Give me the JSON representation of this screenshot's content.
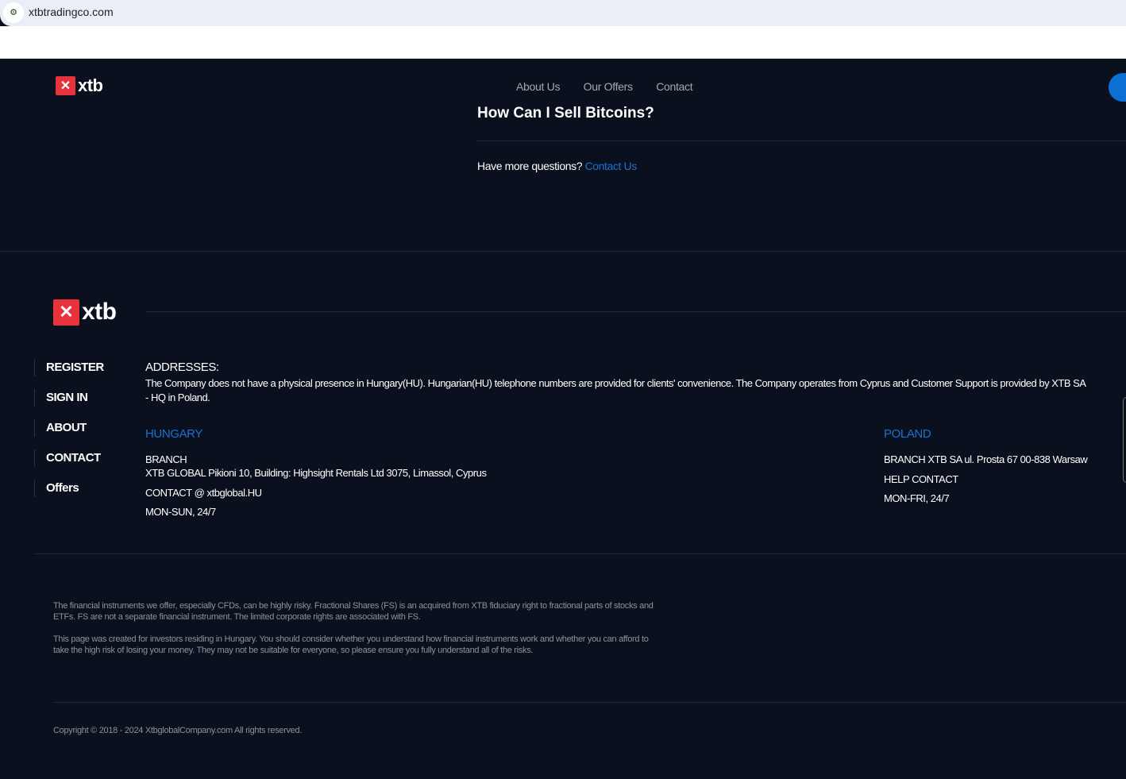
{
  "browser": {
    "url": "xtbtradingco.com",
    "site_info_icon": "tune-icon"
  },
  "header": {
    "logo": "xtb",
    "nav": [
      "About Us",
      "Our Offers",
      "Contact"
    ]
  },
  "faq": {
    "last_question": "How Can I Sell Bitcoins?",
    "more_questions": "Have more questions?",
    "contact_link": "Contact Us"
  },
  "footer": {
    "logo": "xtb",
    "side_links": [
      "REGISTER",
      "SIGN IN",
      "ABOUT",
      "CONTACT",
      "Offers"
    ],
    "addresses_title": "ADDRESSES:",
    "addresses_text": "The Company does not have a physical presence in Hungary(HU). Hungarian(HU) telephone numbers are provided for clients' convenience. The Company operates from Cyprus and Customer Support is provided by XTB SA - HQ in Poland.",
    "hungary": {
      "title": "HUNGARY",
      "branch_label": "BRANCH",
      "branch": "XTB GLOBAL Pikioni 10, Building: Highsight Rentals Ltd 3075, Limassol, Cyprus",
      "contact": "CONTACT @ xtbglobal.HU",
      "hours": "MON-SUN, 24/7"
    },
    "poland": {
      "title": "POLAND",
      "branch": "BRANCH XTB SA ul. Prosta 67 00-838 Warsaw",
      "contact": "HELP CONTACT",
      "hours": "MON-FRI, 24/7"
    },
    "disclaimer1": "The financial instruments we offer, especially CFDs, can be highly risky. Fractional Shares (FS) is an acquired from XTB fiduciary right to fractional parts of stocks and ETFs. FS are not a separate financial instrument. The limited corporate rights are associated with FS.",
    "disclaimer2": "This page was created for investors residing in Hungary. You should consider whether you understand how financial instruments work and whether you can afford to take the high risk of losing your money. They may not be suitable for everyone, so please ensure you fully understand all of the risks.",
    "copyright": "Copyright © 2018 - 2024 XtbglobalCompany.com All rights reserved."
  },
  "colors": {
    "background": "#0a101e",
    "accent": "#1a73d0",
    "logo_red": "#e8323c"
  }
}
